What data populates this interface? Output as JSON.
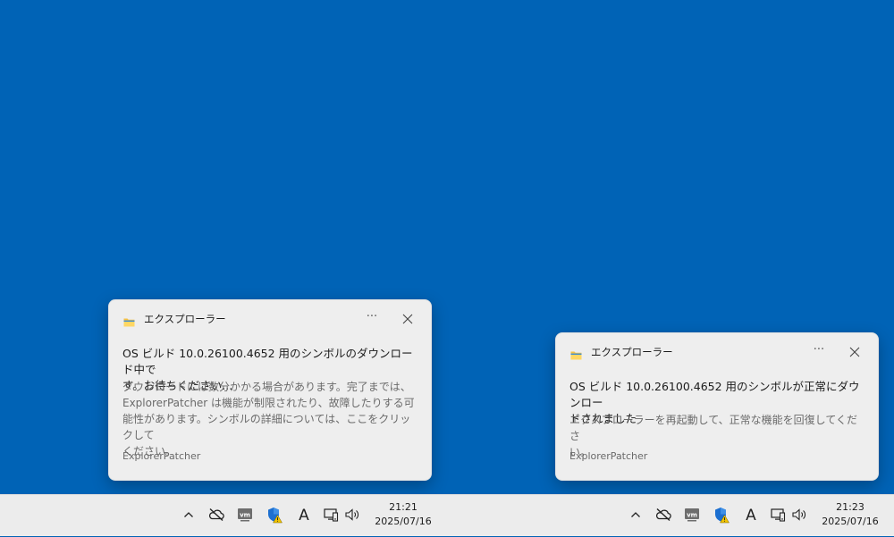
{
  "notifications": [
    {
      "app_name": "エクスプローラー",
      "more_label": "···",
      "title_lines": [
        "OS ビルド 10.0.26100.4652 用のシンボルのダウンロード中で",
        "す。お待ちください..."
      ],
      "body_lines": [
        "ダウンロードには数分かかる場合があります。完了までは、",
        "ExplorerPatcher は機能が制限されたり、故障したりする可",
        "能性があります。シンボルの詳細については、ここをクリックして",
        "ください。"
      ],
      "attribution": "ExplorerPatcher"
    },
    {
      "app_name": "エクスプローラー",
      "more_label": "···",
      "title_lines": [
        "OS ビルド 10.0.26100.4652 用のシンボルが正常にダウンロー",
        "ドされました"
      ],
      "body_lines": [
        "エクスプローラーを再起動して、正常な機能を回復してくださ",
        "い。"
      ],
      "attribution": "ExplorerPatcher"
    }
  ],
  "taskbars": [
    {
      "time": "21:21",
      "date": "2025/07/16",
      "icons": [
        "chevron-up-icon",
        "onedrive-offline-icon",
        "vmware-icon",
        "security-warning-icon",
        "ime-mode-icon",
        "network-icon",
        "volume-icon"
      ],
      "ime_label": "A",
      "vm_label": "vm"
    },
    {
      "time": "21:23",
      "date": "2025/07/16",
      "icons": [
        "chevron-up-icon",
        "onedrive-offline-icon",
        "vmware-icon",
        "security-warning-icon",
        "ime-mode-icon",
        "network-icon",
        "volume-icon"
      ],
      "ime_label": "A",
      "vm_label": "vm"
    }
  ],
  "colors": {
    "desktop_background": "#0063b6",
    "taskbar_background": "#ececec",
    "toast_background": "#eeeeee",
    "shield_blue": "#1c6fd0",
    "warning_yellow": "#f2c400"
  }
}
